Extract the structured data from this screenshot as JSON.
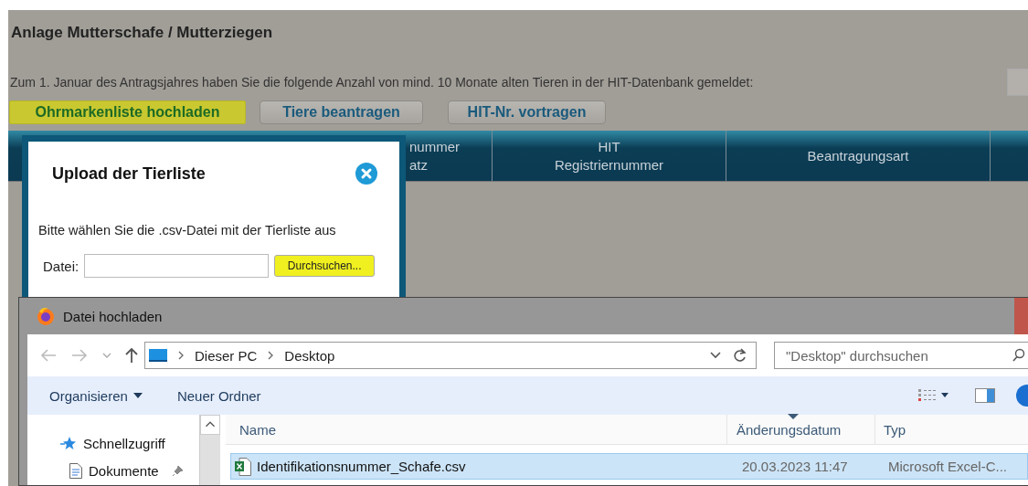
{
  "page": {
    "title": "Anlage Mutterschafe / Mutterziegen",
    "intro": "Zum 1. Januar des Antragsjahres haben Sie die folgende Anzahl von mind. 10 Monate alten Tieren in der HIT-Datenbank gemeldet:"
  },
  "actions": [
    {
      "label": "Ohrmarkenliste hochladen",
      "highlighted": true
    },
    {
      "label": "Tiere beantragen",
      "highlighted": false
    },
    {
      "label": "HIT-Nr. vortragen",
      "highlighted": false
    }
  ],
  "table": {
    "columns": [
      {
        "lines": [
          "nummer",
          "atz"
        ]
      },
      {
        "lines": [
          "HIT",
          "Registriernummer"
        ]
      },
      {
        "lines": [
          "Beantragungsart"
        ]
      }
    ]
  },
  "upload_modal": {
    "title": "Upload der Tierliste",
    "instruction": "Bitte wählen Sie die .csv-Datei mit der Tierliste aus",
    "file_label": "Datei:",
    "browse_button": {
      "label": "Durchsuchen...",
      "highlighted": true
    }
  },
  "file_dialog": {
    "title": "Datei hochladen",
    "path": [
      "Dieser PC",
      "Desktop"
    ],
    "search": {
      "placeholder": "\"Desktop\" durchsuchen"
    },
    "toolbar": [
      {
        "label": "Organisieren",
        "kind": "menu"
      },
      {
        "label": "Neuer Ordner",
        "kind": "button"
      }
    ],
    "nav": [
      {
        "label": "Schnellzugriff",
        "kind": "quick-access"
      },
      {
        "label": "Dokumente",
        "kind": "document"
      }
    ],
    "columns": [
      "Name",
      "Änderungsdatum",
      "Typ"
    ],
    "files": [
      {
        "name": "Identifikationsnummer_Schafe.csv",
        "modified": "20.03.2023 11:47",
        "type": "Microsoft Excel-C...",
        "selected": true
      }
    ]
  }
}
